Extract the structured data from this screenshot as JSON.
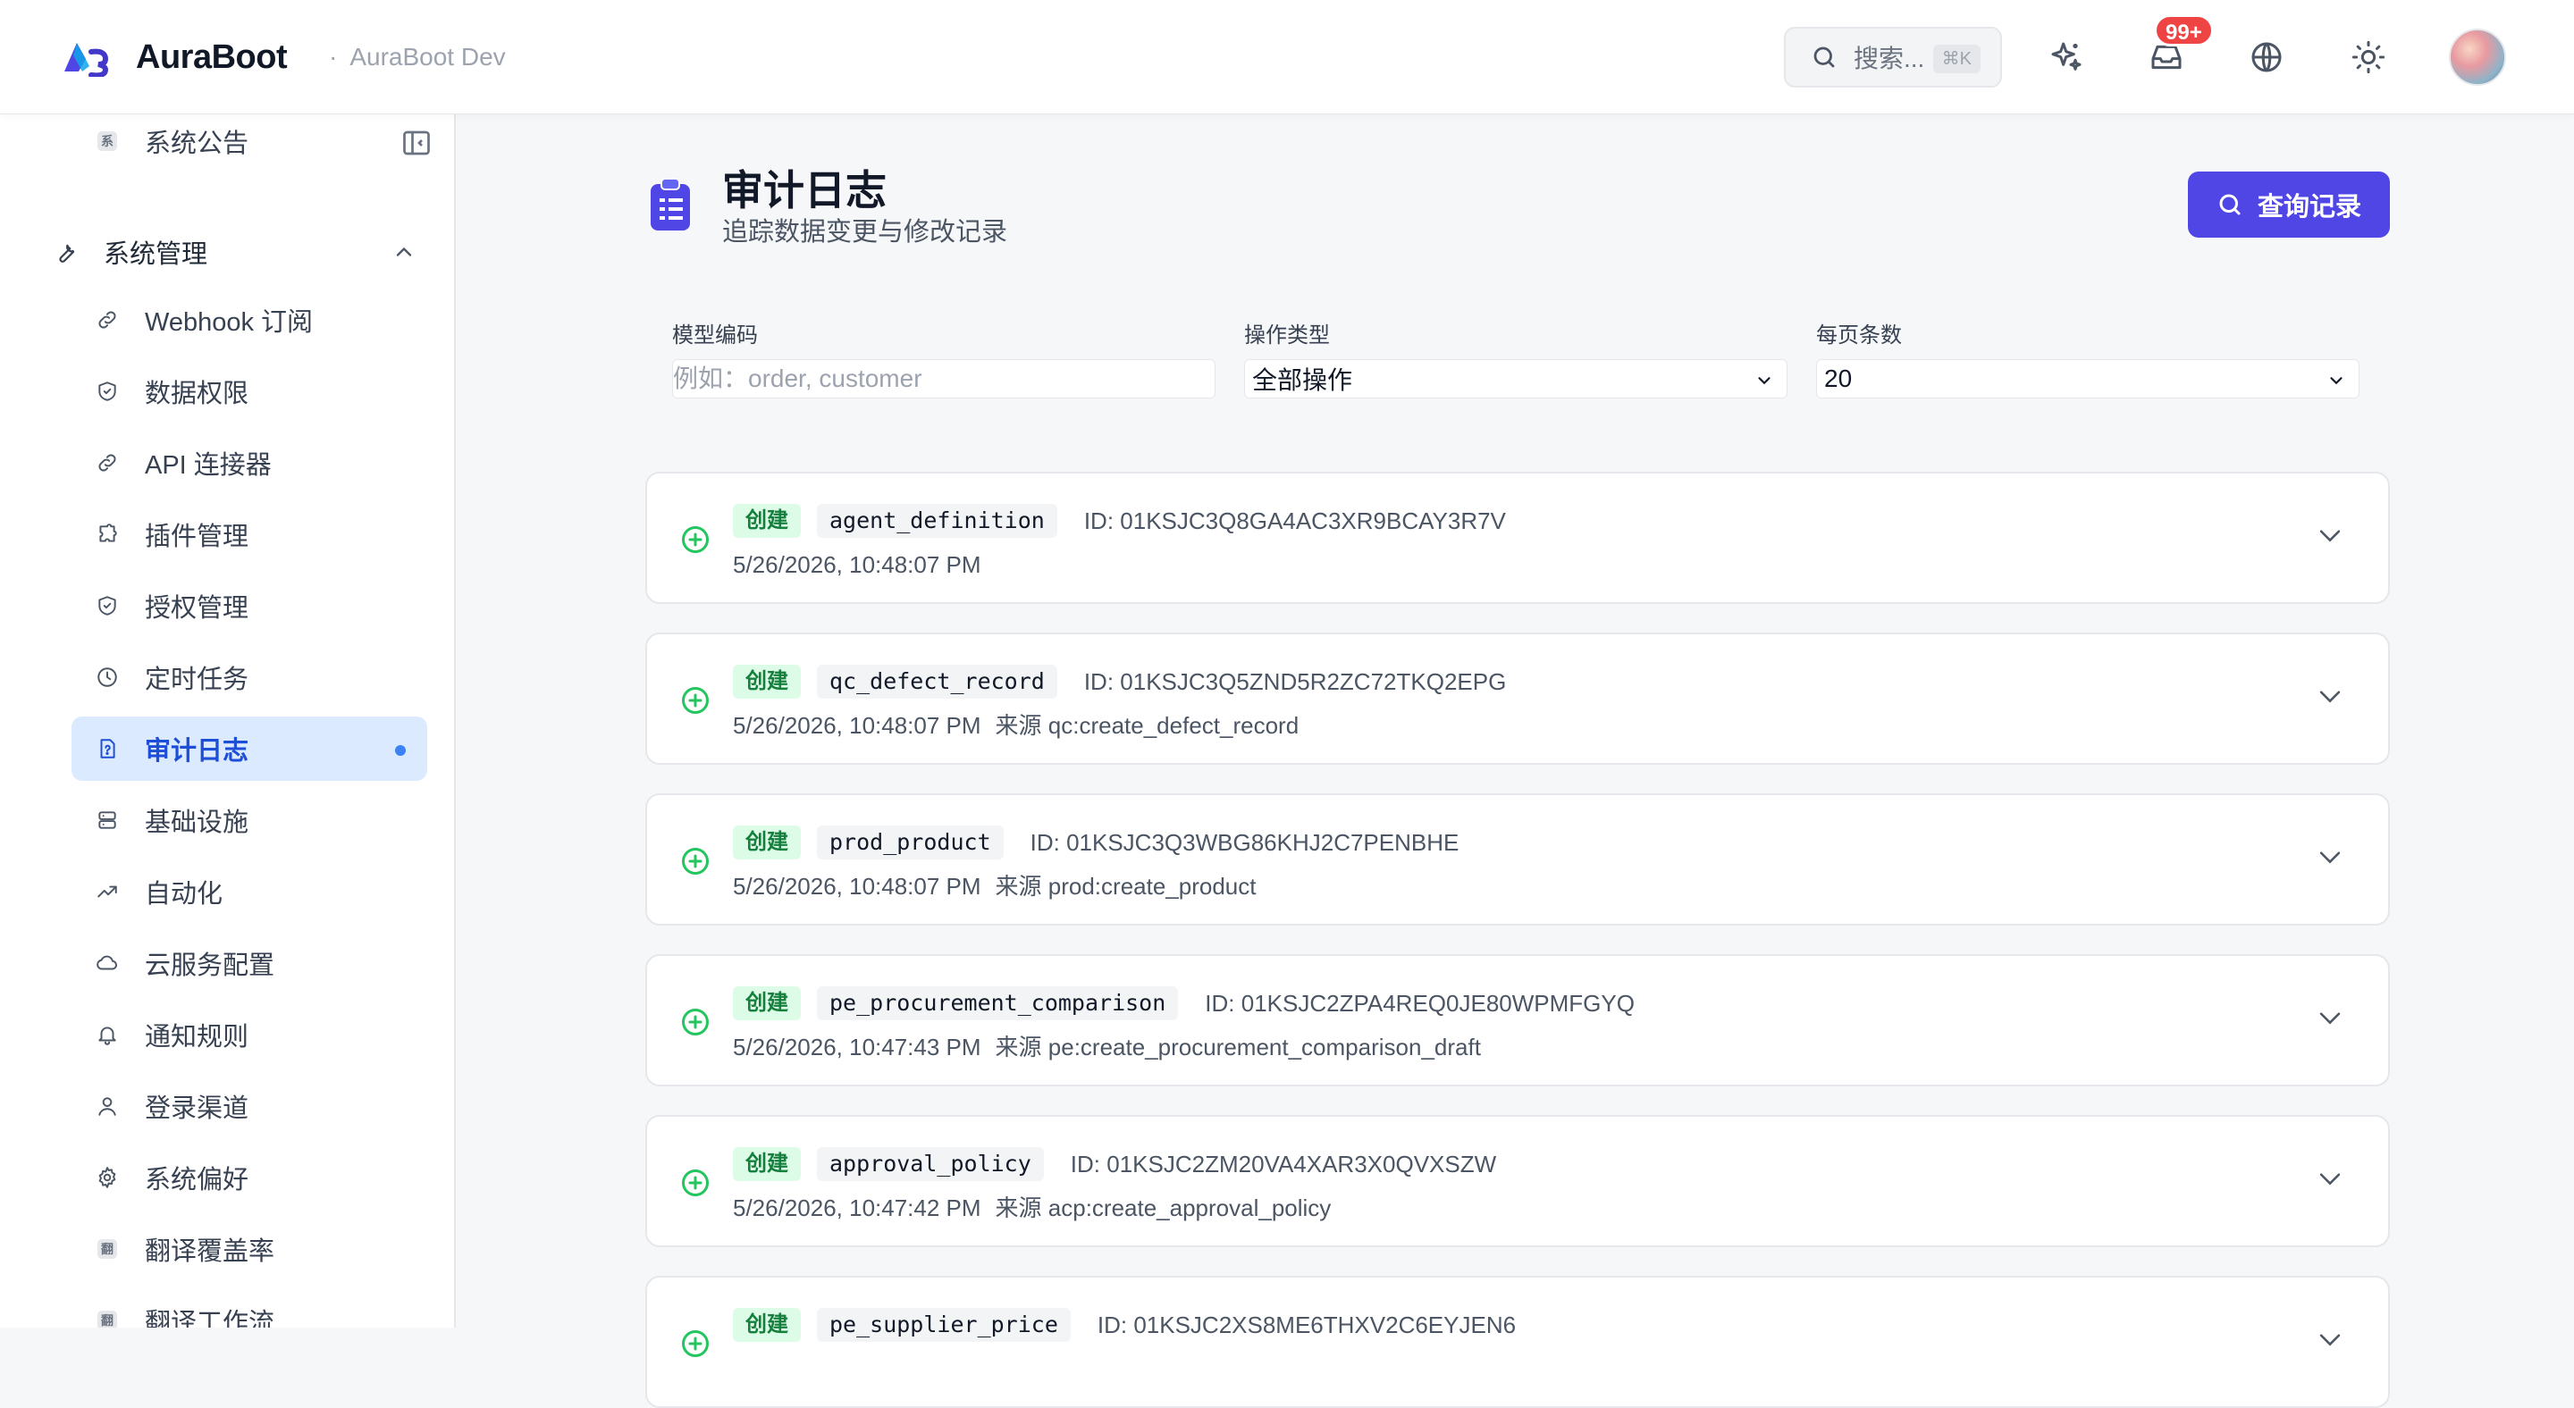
{
  "header": {
    "brand": "AuraBoot",
    "env_sep": "·",
    "env": "AuraBoot Dev",
    "search_label": "搜索...",
    "search_shortcut": "⌘K",
    "notification_badge": "99+",
    "icons": [
      "sparkles-icon",
      "inbox-icon",
      "globe-icon",
      "sun-icon"
    ]
  },
  "sidebar": {
    "top_partial": "系统公告",
    "top_partial_tile": "系",
    "group": "系统管理",
    "items": [
      {
        "label": "Webhook 订阅",
        "icon": "link-icon"
      },
      {
        "label": "数据权限",
        "icon": "shield-icon"
      },
      {
        "label": "API 连接器",
        "icon": "link-icon"
      },
      {
        "label": "插件管理",
        "icon": "puzzle-icon"
      },
      {
        "label": "授权管理",
        "icon": "shield-icon"
      },
      {
        "label": "定时任务",
        "icon": "clock-icon"
      },
      {
        "label": "审计日志",
        "icon": "file-question-icon",
        "active": true
      },
      {
        "label": "基础设施",
        "icon": "server-icon"
      },
      {
        "label": "自动化",
        "icon": "trending-icon"
      },
      {
        "label": "云服务配置",
        "icon": "cloud-icon"
      },
      {
        "label": "通知规则",
        "icon": "bell-icon"
      },
      {
        "label": "登录渠道",
        "icon": "user-icon"
      },
      {
        "label": "系统偏好",
        "icon": "gear-icon"
      },
      {
        "label": "翻译覆盖率",
        "icon": "tile",
        "tile": "翻"
      },
      {
        "label": "翻译工作流",
        "icon": "tile",
        "tile": "翻"
      }
    ]
  },
  "page": {
    "title": "审计日志",
    "subtitle": "追踪数据变更与修改记录",
    "query_button": "查询记录"
  },
  "filters": {
    "model_label": "模型编码",
    "model_placeholder": "例如：order, customer",
    "op_label": "操作类型",
    "op_value": "全部操作",
    "page_size_label": "每页条数",
    "page_size_value": "20"
  },
  "logs": [
    {
      "action": "创建",
      "model": "agent_definition",
      "id": "ID: 01KSJC3Q8GA4AC3XR9BCAY3R7V",
      "time": "5/26/2026, 10:48:07 PM",
      "source": ""
    },
    {
      "action": "创建",
      "model": "qc_defect_record",
      "id": "ID: 01KSJC3Q5ZND5R2ZC72TKQ2EPG",
      "time": "5/26/2026, 10:48:07 PM",
      "source": "来源 qc:create_defect_record"
    },
    {
      "action": "创建",
      "model": "prod_product",
      "id": "ID: 01KSJC3Q3WBG86KHJ2C7PENBHE",
      "time": "5/26/2026, 10:48:07 PM",
      "source": "来源 prod:create_product"
    },
    {
      "action": "创建",
      "model": "pe_procurement_comparison",
      "id": "ID: 01KSJC2ZPA4REQ0JE80WPMFGYQ",
      "time": "5/26/2026, 10:47:43 PM",
      "source": "来源 pe:create_procurement_comparison_draft"
    },
    {
      "action": "创建",
      "model": "approval_policy",
      "id": "ID: 01KSJC2ZM20VA4XAR3X0QVXSZW",
      "time": "5/26/2026, 10:47:42 PM",
      "source": "来源 acp:create_approval_policy"
    },
    {
      "action": "创建",
      "model": "pe_supplier_price",
      "id": "ID: 01KSJC2XS8ME6THXV2C6EYJEN6",
      "time": "",
      "source": ""
    }
  ]
}
